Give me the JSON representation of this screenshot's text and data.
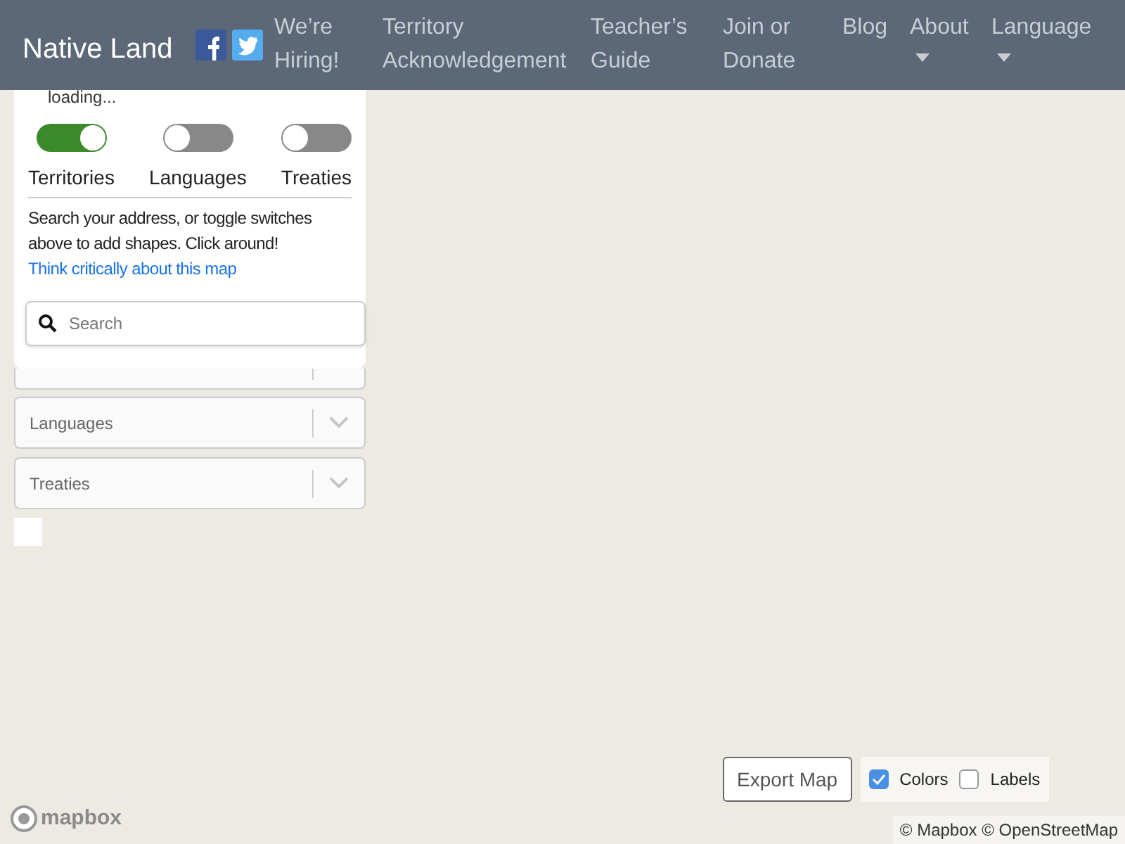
{
  "navbar": {
    "brand": "Native Land",
    "links": [
      {
        "label": "We’re Hiring!",
        "dropdown": false
      },
      {
        "label": "Territory Acknowledgement",
        "dropdown": false
      },
      {
        "label": "Teacher’s Guide",
        "dropdown": false
      },
      {
        "label": "Join or Donate",
        "dropdown": false
      },
      {
        "label": "Blog",
        "dropdown": false
      },
      {
        "label": "About",
        "dropdown": true
      },
      {
        "label": "Language",
        "dropdown": true
      }
    ]
  },
  "panel": {
    "status": "loading...",
    "toggles": [
      {
        "label": "Territories",
        "on": true
      },
      {
        "label": "Languages",
        "on": false
      },
      {
        "label": "Treaties",
        "on": false
      }
    ],
    "help_text": "Search your address, or toggle switches above to add shapes. Click around!",
    "help_link": "Think critically about this map",
    "search": {
      "placeholder": "Search"
    }
  },
  "selects": [
    {
      "label": "Languages"
    },
    {
      "label": "Treaties"
    }
  ],
  "export_button": "Export Map",
  "options": [
    {
      "label": "Colors",
      "checked": true
    },
    {
      "label": "Labels",
      "checked": false
    }
  ],
  "logo": "mapbox",
  "attribution": "© Mapbox © OpenStreetMap"
}
